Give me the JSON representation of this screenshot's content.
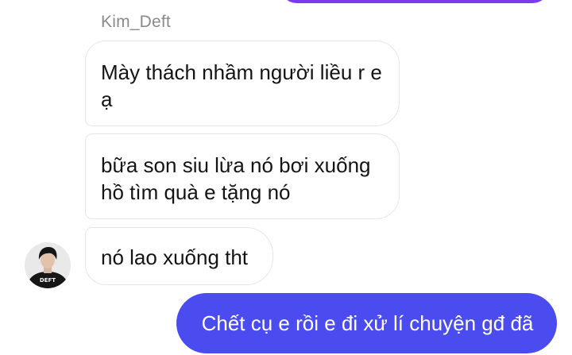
{
  "chat": {
    "sender_name": "Kim_Deft",
    "avatar_caption": "DEFT",
    "incoming": [
      {
        "text": "Mày thách nhầm người liều r e ạ"
      },
      {
        "text": "bữa son siu lừa nó bơi xuống hồ tìm quà e tặng nó"
      },
      {
        "text": "nó lao xuống tht"
      }
    ],
    "outgoing": [
      {
        "text": "Chết cụ e rồi e đi xử lí chuyện gđ đã"
      }
    ]
  },
  "colors": {
    "outgoing_bubble": "#4a4cf0",
    "previous_outgoing_bubble": "#7a3af0",
    "incoming_bubble_border": "#e6e6e6",
    "sender_name_text": "#8a8a8a"
  }
}
